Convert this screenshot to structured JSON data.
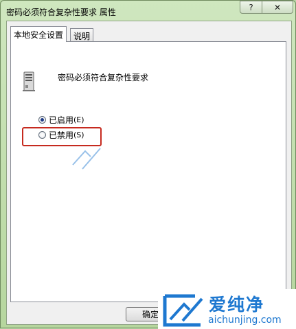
{
  "window": {
    "title": "密码必须符合复杂性要求 属性",
    "help_label": "?",
    "close_label": "✕"
  },
  "tabs": [
    {
      "label": "本地安全设置",
      "active": true
    },
    {
      "label": "说明",
      "active": false
    }
  ],
  "policy": {
    "icon": "server-icon",
    "name": "密码必须符合复杂性要求"
  },
  "options": [
    {
      "label": "已启用",
      "accel": "(E)",
      "checked": true
    },
    {
      "label": "已禁用",
      "accel": "(S)",
      "checked": false
    }
  ],
  "buttons": {
    "ok_label": "确定"
  },
  "watermark": {
    "brand": "爱纯净",
    "url": "aichunjing.com",
    "color": "#1e78d0"
  },
  "colors": {
    "highlight": "#c62a1f",
    "window_frame": "#b6d69e"
  }
}
